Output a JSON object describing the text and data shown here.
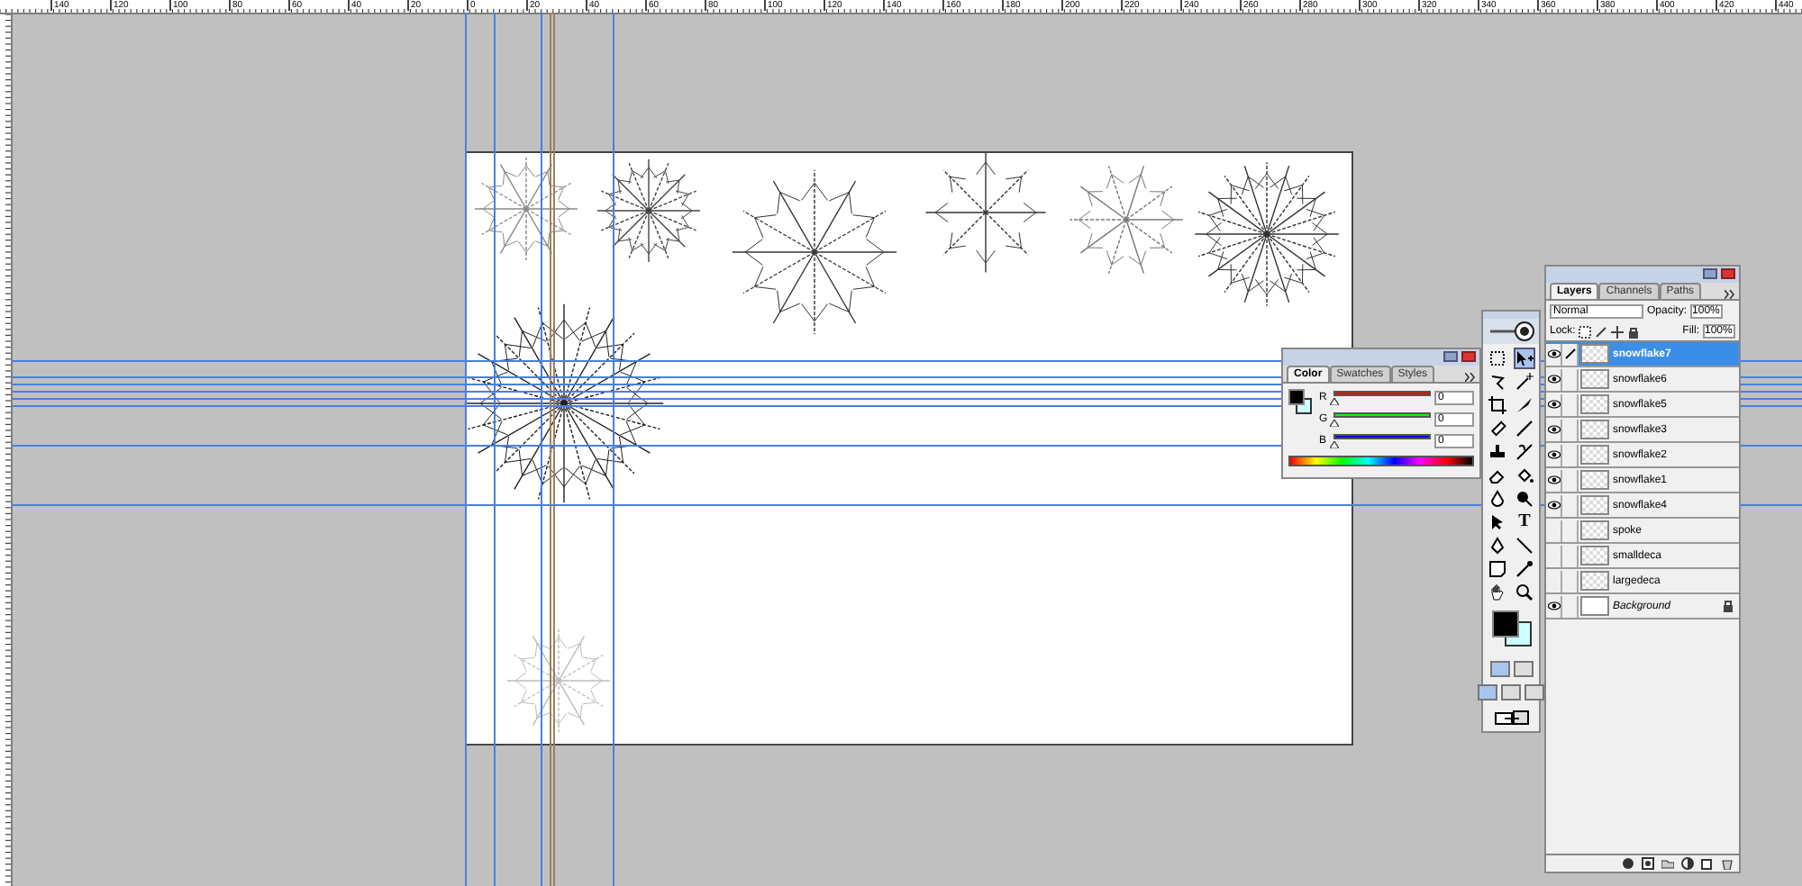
{
  "ruler": {
    "top_labels": [
      "140",
      "120",
      "100",
      "80",
      "60",
      "40",
      "20",
      "0",
      "20",
      "40",
      "60",
      "80",
      "100",
      "120",
      "140",
      "160",
      "180",
      "200",
      "220",
      "240",
      "260",
      "280",
      "300",
      "320",
      "340",
      "360",
      "380",
      "400",
      "420",
      "440"
    ]
  },
  "color_panel": {
    "tabs": [
      {
        "label": "Color",
        "selected": true
      },
      {
        "label": "Swatches",
        "selected": false
      },
      {
        "label": "Styles",
        "selected": false
      }
    ],
    "channels": [
      {
        "label": "R",
        "value": "0",
        "level": 0,
        "color": "#ff0000"
      },
      {
        "label": "G",
        "value": "0",
        "level": 0,
        "color": "#00ff00"
      },
      {
        "label": "B",
        "value": "0",
        "level": 0,
        "color": "#0000ff"
      }
    ]
  },
  "toolbox": {
    "type_tool_glyph": "T"
  },
  "layers_panel": {
    "tabs": [
      {
        "label": "Layers",
        "selected": true
      },
      {
        "label": "Channels",
        "selected": false
      },
      {
        "label": "Paths",
        "selected": false
      }
    ],
    "blend_mode": "Normal",
    "opacity_label": "Opacity:",
    "opacity": "100%",
    "lock_label": "Lock:",
    "fill_label": "Fill:",
    "fill": "100%",
    "layers": [
      {
        "name": "snowflake7",
        "selected": true,
        "visible": true,
        "kind": "layer"
      },
      {
        "name": "snowflake6",
        "selected": false,
        "visible": true,
        "kind": "layer"
      },
      {
        "name": "snowflake5",
        "selected": false,
        "visible": true,
        "kind": "layer"
      },
      {
        "name": "snowflake3",
        "selected": false,
        "visible": true,
        "kind": "layer"
      },
      {
        "name": "snowflake2",
        "selected": false,
        "visible": true,
        "kind": "layer"
      },
      {
        "name": "snowflake1",
        "selected": false,
        "visible": true,
        "kind": "layer"
      },
      {
        "name": "snowflake4",
        "selected": false,
        "visible": true,
        "kind": "layer"
      },
      {
        "name": "spoke",
        "selected": false,
        "visible": false,
        "kind": "layer"
      },
      {
        "name": "smalldeca",
        "selected": false,
        "visible": false,
        "kind": "layer"
      },
      {
        "name": "largedeca",
        "selected": false,
        "visible": false,
        "kind": "layer"
      },
      {
        "name": "Background",
        "selected": false,
        "visible": true,
        "kind": "background"
      }
    ]
  }
}
